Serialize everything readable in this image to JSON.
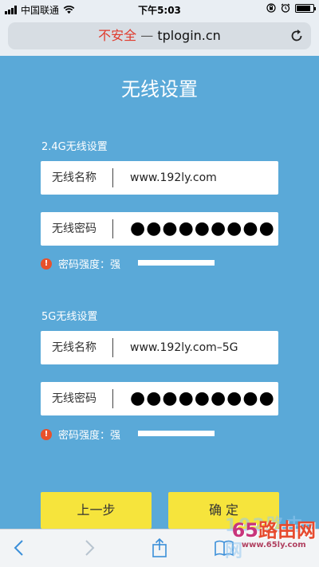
{
  "status_bar": {
    "carrier": "中国联通",
    "time": "下午5:03",
    "battery_level": 0.85
  },
  "address_bar": {
    "insecure_label": "不安全",
    "separator": "—",
    "host": "tplogin.cn"
  },
  "page": {
    "title": "无线设置",
    "band_24": {
      "section_label": "2.4G无线设置",
      "ssid_label": "无线名称",
      "ssid_value": "www.192ly.com",
      "password_label": "无线密码",
      "password_value": "●●●●●●●●●",
      "strength_label": "密码强度：强"
    },
    "band_5": {
      "section_label": "5G无线设置",
      "ssid_label": "无线名称",
      "ssid_value": "www.192ly.com–5G",
      "password_label": "无线密码",
      "password_value": "●●●●●●●●●",
      "strength_label": "密码强度：强"
    },
    "buttons": {
      "prev": "上一步",
      "confirm": "确 定"
    }
  },
  "watermark": {
    "ghost": "192路由网",
    "main_num": "65",
    "main_text": "路由网",
    "sub": "www.65ly.com"
  },
  "colors": {
    "background": "#5aa9d8",
    "button": "#f6e43c",
    "insecure": "#e0392b",
    "warning": "#e8512b"
  },
  "icons": [
    "signal-icon",
    "wifi-icon",
    "lock-rotation-icon",
    "alarm-icon",
    "battery-icon",
    "reload-icon",
    "back-icon",
    "forward-icon",
    "share-icon",
    "bookmarks-icon",
    "warning-icon"
  ]
}
